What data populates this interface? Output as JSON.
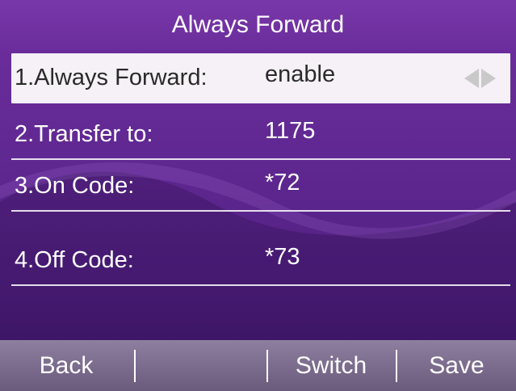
{
  "title": "Always Forward",
  "rows": [
    {
      "label": "1.Always Forward:",
      "value": "enable",
      "selected": true
    },
    {
      "label": "2.Transfer to:",
      "value": "1175"
    },
    {
      "label": "3.On Code:",
      "value": "*72"
    },
    {
      "label": "4.Off Code:",
      "value": "*73"
    }
  ],
  "softkeys": [
    "Back",
    "",
    "Switch",
    "Save"
  ],
  "colors": {
    "background": "#5e2790",
    "selected_row": "#f6f1f7",
    "softkey_bar": "#7d6e90"
  }
}
